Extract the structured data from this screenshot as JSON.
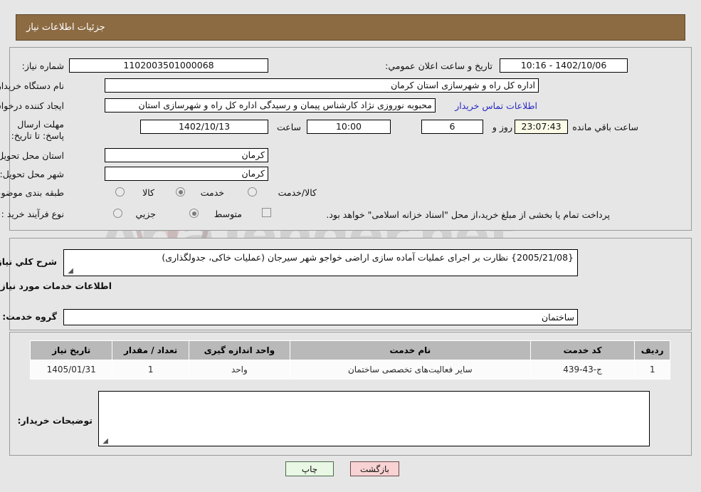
{
  "header": {
    "title": "جزئیات اطلاعات نیاز"
  },
  "watermark": {
    "text": "AriaTender.net"
  },
  "fields": {
    "need_number_label": "شماره نیاز:",
    "need_number_value": "1102003501000068",
    "announce_label": "تاریخ و ساعت اعلان عمومي:",
    "announce_value": "1402/10/06 - 10:16",
    "buyer_org_label": "نام دستگاه خریدار:",
    "buyer_org_value": "اداره کل راه و شهرسازی استان کرمان",
    "requester_label": "ایجاد کننده درخواست:",
    "requester_value": "محبوبه نوروزی نژاد کارشناس پیمان و رسیدگی اداره کل راه و شهرسازی استان",
    "contact_link": "اطلاعات تماس خریدار",
    "deadline_label": "مهلت ارسال پاسخ: تا تاریخ:",
    "deadline_date": "1402/10/13",
    "hour_label": "ساعت",
    "hour_value": "10:00",
    "days_value": "6",
    "days_and_label": "روز و",
    "countdown_value": "23:07:43",
    "remaining_label": "ساعت باقي مانده",
    "province_label": "استان محل تحویل:",
    "province_value": "کرمان",
    "city_label": "شهر محل تحویل:",
    "city_value": "کرمان",
    "category_label": "طبقه بندی موضوعی:",
    "category_options": [
      "کالا",
      "خدمت",
      "کالا/خدمت"
    ],
    "category_selected": "خدمت",
    "process_label": "نوع فرآیند خرید :",
    "process_options": [
      "جزیي",
      "متوسط"
    ],
    "process_selected": "متوسط",
    "treasury_note": "پرداخت تمام یا بخشی از مبلغ خرید،از محل \"اسناد خزانه اسلامی\" خواهد بود."
  },
  "summary": {
    "label": "شرح کلي نیاز:",
    "value": "{2005/21/08} نظارت بر اجرای عملیات آماده سازی اراضی خواجو شهر سیرجان (عملیات خاکی، جدولگذاری)"
  },
  "services": {
    "heading": "اطلاعات خدمات مورد نیاز",
    "group_label": "گروه خدمت:",
    "group_value": "ساختمان",
    "table": {
      "columns": [
        "ردیف",
        "کد خدمت",
        "نام خدمت",
        "واحد اندازه گیری",
        "تعداد / مقدار",
        "تاریخ نیاز"
      ],
      "rows": [
        [
          "1",
          "ج-43-439",
          "سایر فعالیت‌های تخصصی ساختمان",
          "واحد",
          "1",
          "1405/01/31"
        ]
      ]
    }
  },
  "buyer_notes": {
    "label": "توضیحات خریدار:",
    "value": ""
  },
  "buttons": {
    "back": "بازگشت",
    "print": "چاپ"
  },
  "colors": {
    "header_bg": "#8c6b43",
    "page_bg": "#e6e6e6",
    "link": "#2b2bc4",
    "countdown_bg": "#fbfbe7",
    "back_btn_bg": "#f9d3d3",
    "print_btn_bg": "#e9f7e5",
    "table_header_bg": "#b9b9b9"
  }
}
